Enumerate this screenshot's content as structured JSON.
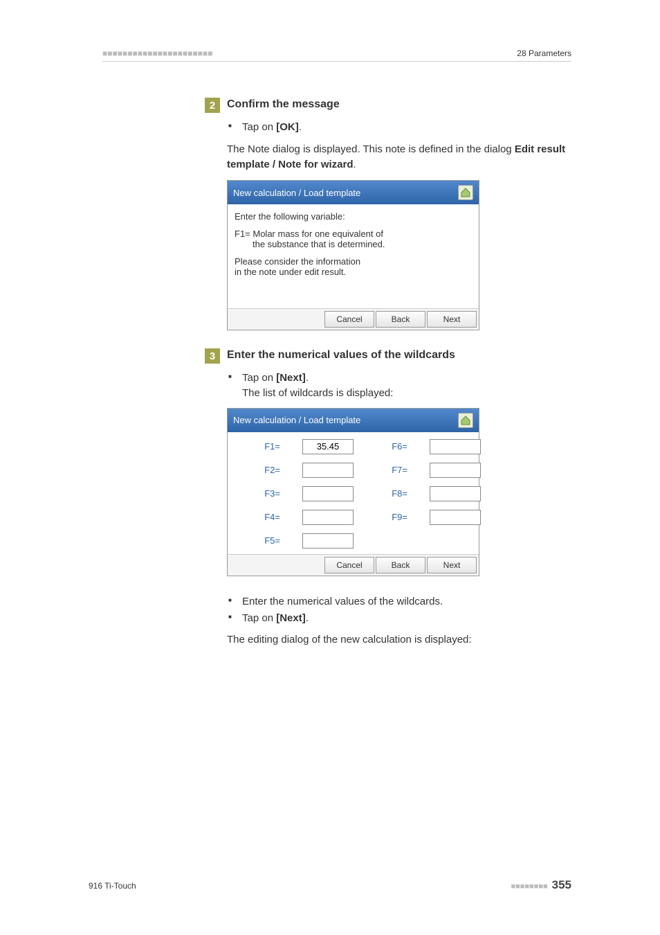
{
  "header": {
    "right": "28 Parameters"
  },
  "step2": {
    "num": "2",
    "title": "Confirm the message",
    "tap_prefix": "Tap on ",
    "tap_bold": "[OK]",
    "tap_suffix": ".",
    "para_a": "The Note dialog is displayed. This note is defined in the dialog ",
    "para_b": "Edit result template / Note for wizard",
    "para_c": "."
  },
  "dlg1": {
    "title": "New calculation / Load template",
    "line1": "Enter the following variable:",
    "line2a": "F1= Molar mass for one equivalent of",
    "line2b": "the substance that is determined.",
    "line3": "Please consider the information",
    "line4": "in the note under edit result.",
    "btn_cancel": "Cancel",
    "btn_back": "Back",
    "btn_next": "Next"
  },
  "step3": {
    "num": "3",
    "title": "Enter the numerical values of the wildcards",
    "bullet1_prefix": "Tap on ",
    "bullet1_bold": "[Next]",
    "bullet1_suffix": ".",
    "subline": "The list of wildcards is displayed:"
  },
  "dlg2": {
    "title": "New calculation / Load template",
    "labels": {
      "f1": "F1=",
      "f2": "F2=",
      "f3": "F3=",
      "f4": "F4=",
      "f5": "F5=",
      "f6": "F6=",
      "f7": "F7=",
      "f8": "F8=",
      "f9": "F9="
    },
    "values": {
      "f1": "35.45"
    },
    "btn_cancel": "Cancel",
    "btn_back": "Back",
    "btn_next": "Next"
  },
  "post": {
    "bullet2": "Enter the numerical values of the wildcards.",
    "bullet3_prefix": "Tap on ",
    "bullet3_bold": "[Next]",
    "bullet3_suffix": ".",
    "para": "The editing dialog of the new calculation is displayed:"
  },
  "footer": {
    "left": "916 Ti-Touch",
    "page": "355"
  }
}
